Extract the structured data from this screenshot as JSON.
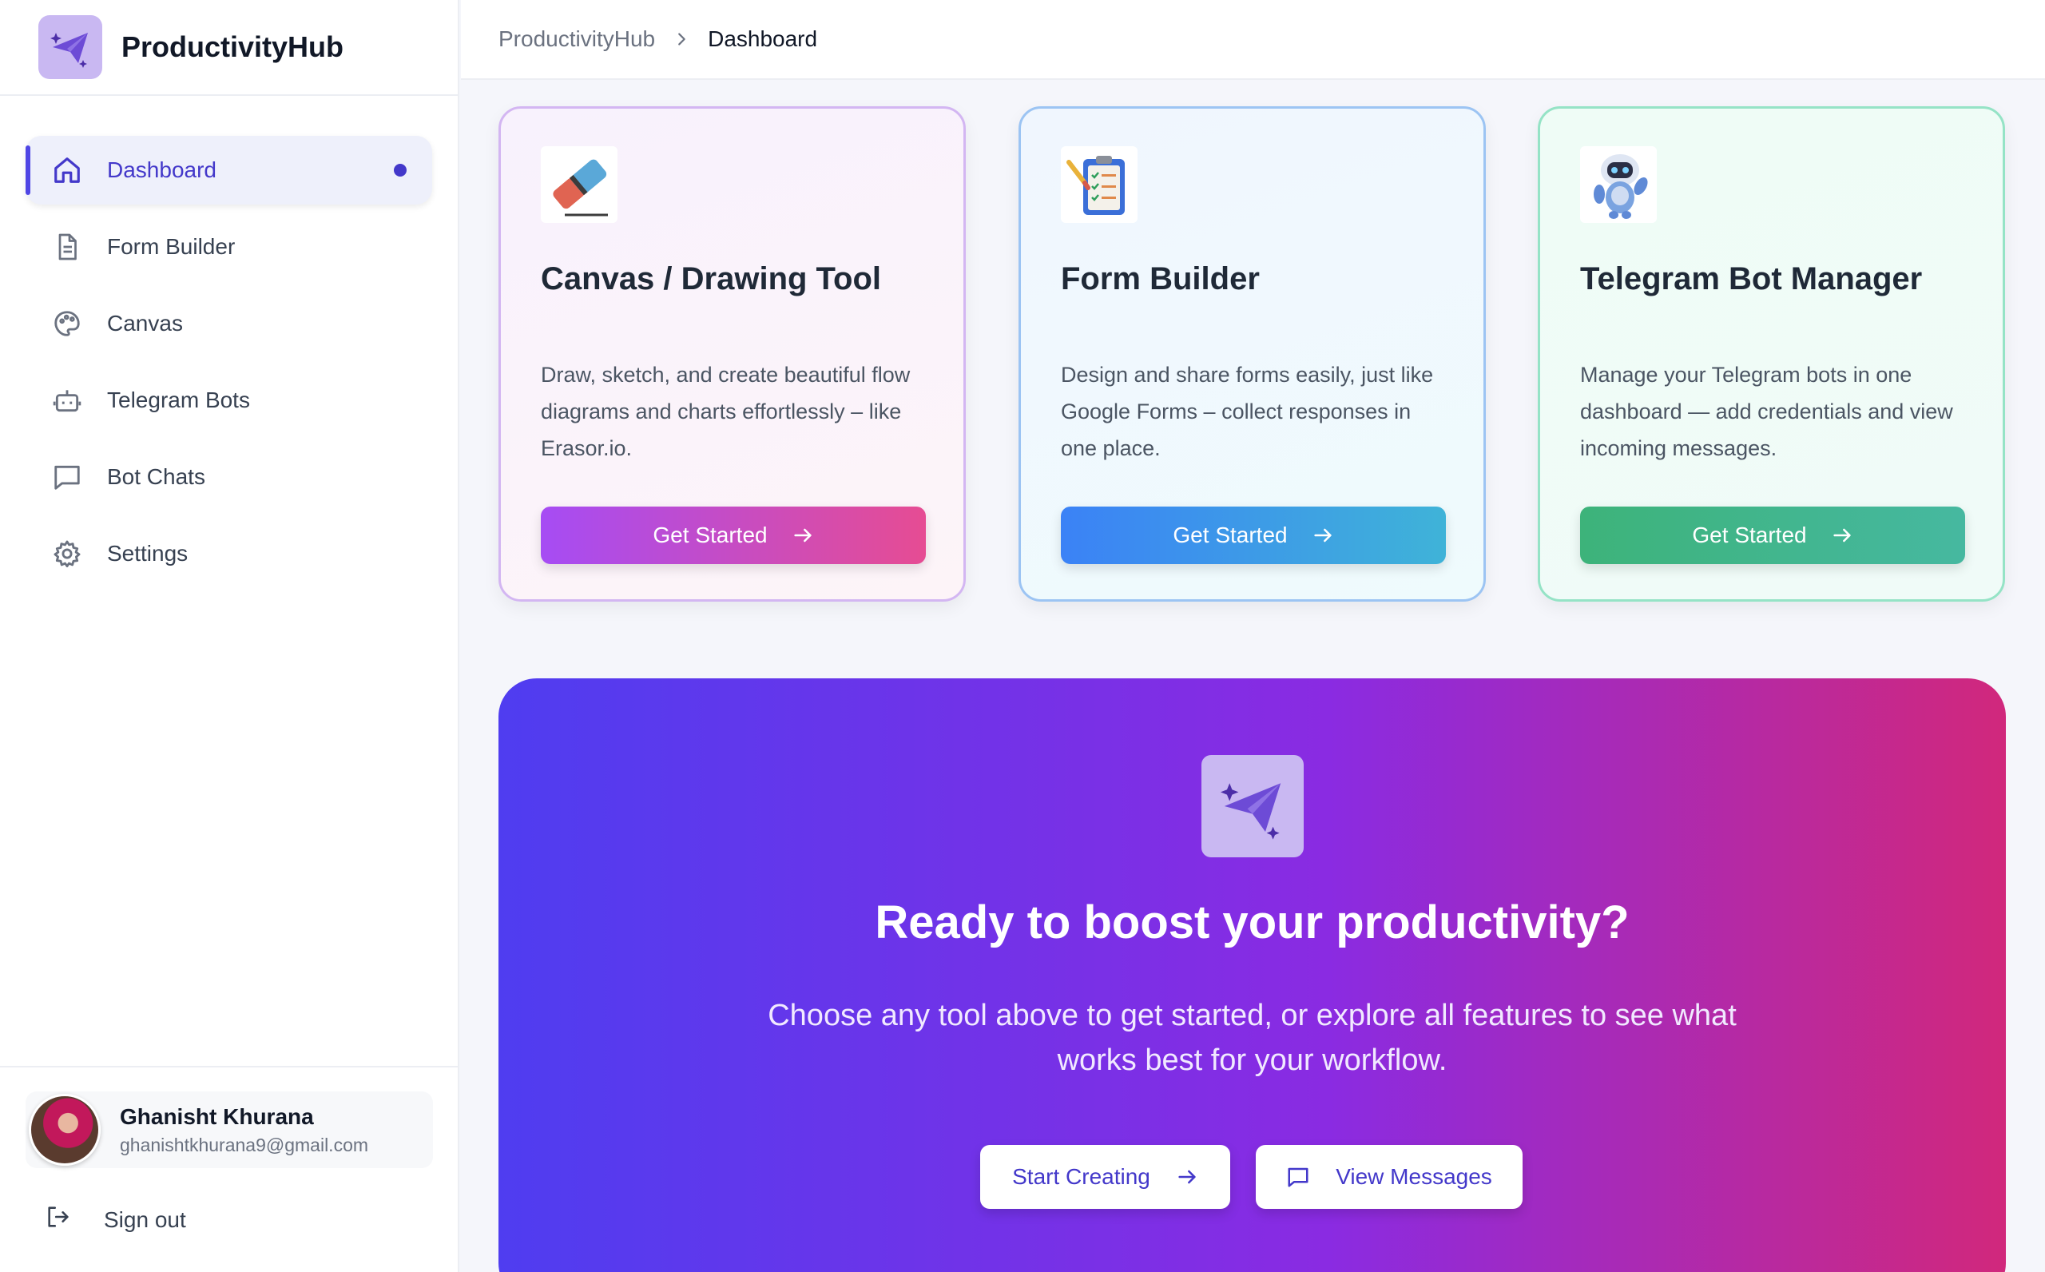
{
  "colors": {
    "accent": "#4f46e5",
    "sidebar_bg": "#ffffff",
    "page_bg": "#f5f6fb"
  },
  "brand": {
    "name": "ProductivityHub",
    "icon": "paper-plane-sparkle-icon"
  },
  "breadcrumb": {
    "root": "ProductivityHub",
    "current": "Dashboard"
  },
  "sidebar": {
    "items": [
      {
        "label": "Dashboard",
        "icon": "home-icon",
        "active": true
      },
      {
        "label": "Form Builder",
        "icon": "document-icon",
        "active": false
      },
      {
        "label": "Canvas",
        "icon": "palette-icon",
        "active": false
      },
      {
        "label": "Telegram Bots",
        "icon": "robot-icon",
        "active": false
      },
      {
        "label": "Bot Chats",
        "icon": "chat-bubble-icon",
        "active": false
      },
      {
        "label": "Settings",
        "icon": "gear-icon",
        "active": false
      }
    ],
    "user": {
      "name": "Ghanisht Khurana",
      "email": "ghanishtkhurana9@gmail.com"
    },
    "signout_label": "Sign out"
  },
  "cards": [
    {
      "title": "Canvas / Drawing Tool",
      "description": "Draw, sketch, and create beautiful flow diagrams and charts effortlessly – like Erasor.io.",
      "button": "Get Started",
      "icon": "eraser-icon"
    },
    {
      "title": "Form Builder",
      "description": "Design and share forms easily, just like Google Forms – collect responses in one place.",
      "button": "Get Started",
      "icon": "clipboard-checklist-icon"
    },
    {
      "title": "Telegram Bot Manager",
      "description": "Manage your Telegram bots in one dashboard — add credentials and view incoming messages.",
      "button": "Get Started",
      "icon": "robot-mascot-icon"
    }
  ],
  "cta": {
    "title": "Ready to boost your productivity?",
    "text": "Choose any tool above to get started, or explore all features to see what works best for your workflow.",
    "primary_button": "Start Creating",
    "secondary_button": "View Messages"
  }
}
